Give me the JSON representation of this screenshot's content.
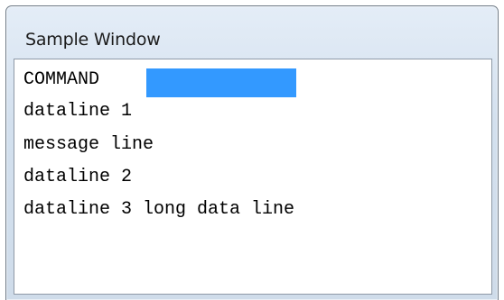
{
  "window": {
    "title": "Sample Window"
  },
  "content": {
    "command_label": "COMMAND",
    "command_value": "",
    "lines": [
      "dataline 1",
      "message line",
      "dataline 2",
      "dataline 3 long data line"
    ]
  },
  "colors": {
    "input_highlight": "#3399ff",
    "titlebar": "#d3e0ee",
    "text": "#000000"
  }
}
